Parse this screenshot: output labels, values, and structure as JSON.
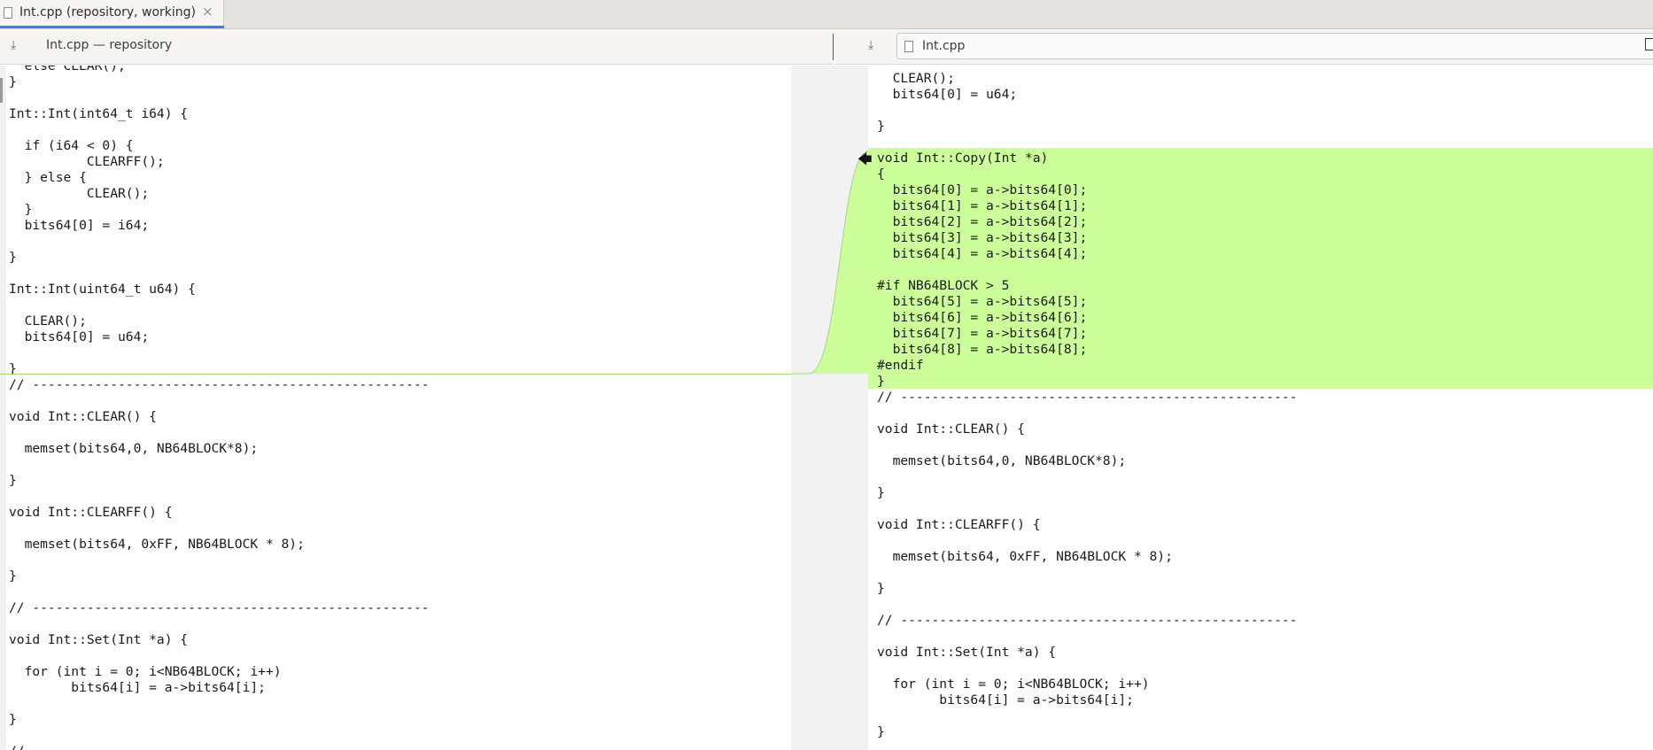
{
  "tab": {
    "label": "Int.cpp (repository, working)",
    "close": "×"
  },
  "left_header": {
    "download_icon": "⤓",
    "label": "Int.cpp — repository"
  },
  "right_header": {
    "download_icon": "⤓",
    "label": "Int.cpp"
  },
  "colors": {
    "added_bg": "#ccff99",
    "accent": "#3584e4"
  },
  "left_lines": [
    "  else CLEAR();",
    "}",
    "",
    "Int::Int(int64_t i64) {",
    "",
    "  if (i64 < 0) {",
    "          CLEARFF();",
    "  } else {",
    "          CLEAR();",
    "  }",
    "  bits64[0] = i64;",
    "",
    "}",
    "",
    "Int::Int(uint64_t u64) {",
    "",
    "  CLEAR();",
    "  bits64[0] = u64;",
    "",
    "}",
    "// ---------------------------------------------------",
    "",
    "void Int::CLEAR() {",
    "",
    "  memset(bits64,0, NB64BLOCK*8);",
    "",
    "}",
    "",
    "void Int::CLEARFF() {",
    "",
    "  memset(bits64, 0xFF, NB64BLOCK * 8);",
    "",
    "}",
    "",
    "// ---------------------------------------------------",
    "",
    "void Int::Set(Int *a) {",
    "",
    "  for (int i = 0; i<NB64BLOCK; i++)",
    "        bits64[i] = a->bits64[i];",
    "",
    "}",
    "",
    "//"
  ],
  "right_lines": [
    "  CLEAR();",
    "  bits64[0] = u64;",
    "",
    "}",
    "",
    "void Int::Copy(Int *a)",
    "{",
    "  bits64[0] = a->bits64[0];",
    "  bits64[1] = a->bits64[1];",
    "  bits64[2] = a->bits64[2];",
    "  bits64[3] = a->bits64[3];",
    "  bits64[4] = a->bits64[4];",
    "",
    "#if NB64BLOCK > 5",
    "  bits64[5] = a->bits64[5];",
    "  bits64[6] = a->bits64[6];",
    "  bits64[7] = a->bits64[7];",
    "  bits64[8] = a->bits64[8];",
    "#endif",
    "}",
    "// ---------------------------------------------------",
    "",
    "void Int::CLEAR() {",
    "",
    "  memset(bits64,0, NB64BLOCK*8);",
    "",
    "}",
    "",
    "void Int::CLEARFF() {",
    "",
    "  memset(bits64, 0xFF, NB64BLOCK * 8);",
    "",
    "}",
    "",
    "// ---------------------------------------------------",
    "",
    "void Int::Set(Int *a) {",
    "",
    "  for (int i = 0; i<NB64BLOCK; i++)",
    "        bits64[i] = a->bits64[i];",
    "",
    "}",
    "",
    "//"
  ],
  "added_block": {
    "first_line": 5,
    "last_line": 19
  },
  "merge_arrow": "🡄"
}
